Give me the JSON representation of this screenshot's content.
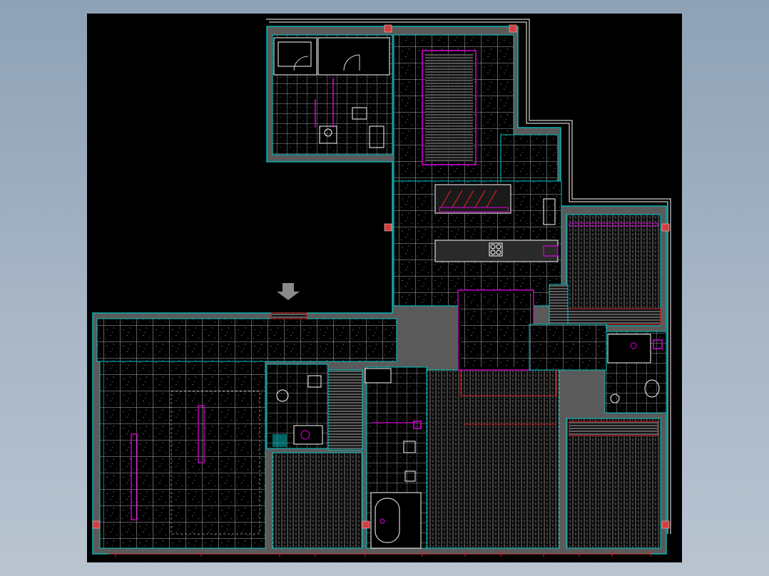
{
  "app": {
    "background_color": "#9aabbd",
    "viewport_color": "#000000"
  },
  "drawing": {
    "type": "architectural floor plan",
    "colors": {
      "wall_outline": "#00c8c8",
      "wall_fill": "#5a5a5a",
      "tile_grid": "#ffffff",
      "hatch": "#b4b4b4",
      "fixture": "#e000e0",
      "dimension": "#e02020",
      "column": "#d04040",
      "boundary": "#ffffff",
      "arrow": "#8a8a8a"
    },
    "icons": [
      "down-arrow-icon",
      "bathtub-icon",
      "sink-icon",
      "toilet-icon",
      "stove-icon",
      "door-swing-icon",
      "column-marker-icon"
    ]
  }
}
